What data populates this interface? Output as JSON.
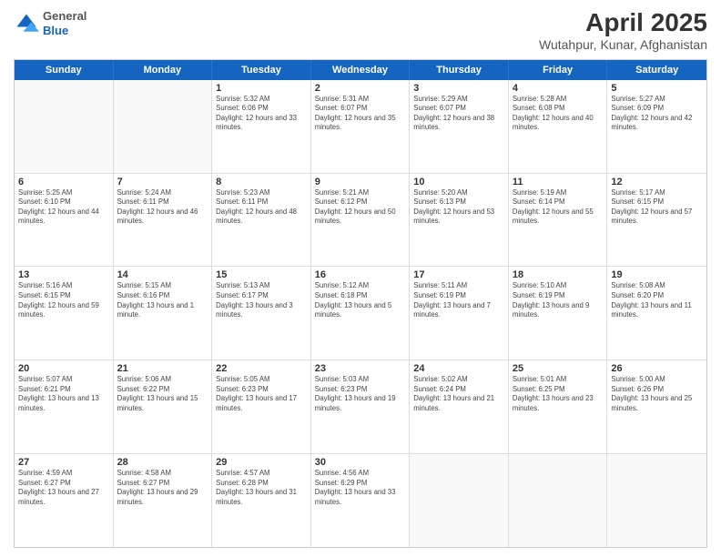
{
  "header": {
    "logo": {
      "general": "General",
      "blue": "Blue"
    },
    "title": "April 2025",
    "location": "Wutahpur, Kunar, Afghanistan"
  },
  "weekdays": [
    "Sunday",
    "Monday",
    "Tuesday",
    "Wednesday",
    "Thursday",
    "Friday",
    "Saturday"
  ],
  "weeks": [
    [
      {
        "day": "",
        "sunrise": "",
        "sunset": "",
        "daylight": ""
      },
      {
        "day": "",
        "sunrise": "",
        "sunset": "",
        "daylight": ""
      },
      {
        "day": "1",
        "sunrise": "Sunrise: 5:32 AM",
        "sunset": "Sunset: 6:06 PM",
        "daylight": "Daylight: 12 hours and 33 minutes."
      },
      {
        "day": "2",
        "sunrise": "Sunrise: 5:31 AM",
        "sunset": "Sunset: 6:07 PM",
        "daylight": "Daylight: 12 hours and 35 minutes."
      },
      {
        "day": "3",
        "sunrise": "Sunrise: 5:29 AM",
        "sunset": "Sunset: 6:07 PM",
        "daylight": "Daylight: 12 hours and 38 minutes."
      },
      {
        "day": "4",
        "sunrise": "Sunrise: 5:28 AM",
        "sunset": "Sunset: 6:08 PM",
        "daylight": "Daylight: 12 hours and 40 minutes."
      },
      {
        "day": "5",
        "sunrise": "Sunrise: 5:27 AM",
        "sunset": "Sunset: 6:09 PM",
        "daylight": "Daylight: 12 hours and 42 minutes."
      }
    ],
    [
      {
        "day": "6",
        "sunrise": "Sunrise: 5:25 AM",
        "sunset": "Sunset: 6:10 PM",
        "daylight": "Daylight: 12 hours and 44 minutes."
      },
      {
        "day": "7",
        "sunrise": "Sunrise: 5:24 AM",
        "sunset": "Sunset: 6:11 PM",
        "daylight": "Daylight: 12 hours and 46 minutes."
      },
      {
        "day": "8",
        "sunrise": "Sunrise: 5:23 AM",
        "sunset": "Sunset: 6:11 PM",
        "daylight": "Daylight: 12 hours and 48 minutes."
      },
      {
        "day": "9",
        "sunrise": "Sunrise: 5:21 AM",
        "sunset": "Sunset: 6:12 PM",
        "daylight": "Daylight: 12 hours and 50 minutes."
      },
      {
        "day": "10",
        "sunrise": "Sunrise: 5:20 AM",
        "sunset": "Sunset: 6:13 PM",
        "daylight": "Daylight: 12 hours and 53 minutes."
      },
      {
        "day": "11",
        "sunrise": "Sunrise: 5:19 AM",
        "sunset": "Sunset: 6:14 PM",
        "daylight": "Daylight: 12 hours and 55 minutes."
      },
      {
        "day": "12",
        "sunrise": "Sunrise: 5:17 AM",
        "sunset": "Sunset: 6:15 PM",
        "daylight": "Daylight: 12 hours and 57 minutes."
      }
    ],
    [
      {
        "day": "13",
        "sunrise": "Sunrise: 5:16 AM",
        "sunset": "Sunset: 6:15 PM",
        "daylight": "Daylight: 12 hours and 59 minutes."
      },
      {
        "day": "14",
        "sunrise": "Sunrise: 5:15 AM",
        "sunset": "Sunset: 6:16 PM",
        "daylight": "Daylight: 13 hours and 1 minute."
      },
      {
        "day": "15",
        "sunrise": "Sunrise: 5:13 AM",
        "sunset": "Sunset: 6:17 PM",
        "daylight": "Daylight: 13 hours and 3 minutes."
      },
      {
        "day": "16",
        "sunrise": "Sunrise: 5:12 AM",
        "sunset": "Sunset: 6:18 PM",
        "daylight": "Daylight: 13 hours and 5 minutes."
      },
      {
        "day": "17",
        "sunrise": "Sunrise: 5:11 AM",
        "sunset": "Sunset: 6:19 PM",
        "daylight": "Daylight: 13 hours and 7 minutes."
      },
      {
        "day": "18",
        "sunrise": "Sunrise: 5:10 AM",
        "sunset": "Sunset: 6:19 PM",
        "daylight": "Daylight: 13 hours and 9 minutes."
      },
      {
        "day": "19",
        "sunrise": "Sunrise: 5:08 AM",
        "sunset": "Sunset: 6:20 PM",
        "daylight": "Daylight: 13 hours and 11 minutes."
      }
    ],
    [
      {
        "day": "20",
        "sunrise": "Sunrise: 5:07 AM",
        "sunset": "Sunset: 6:21 PM",
        "daylight": "Daylight: 13 hours and 13 minutes."
      },
      {
        "day": "21",
        "sunrise": "Sunrise: 5:06 AM",
        "sunset": "Sunset: 6:22 PM",
        "daylight": "Daylight: 13 hours and 15 minutes."
      },
      {
        "day": "22",
        "sunrise": "Sunrise: 5:05 AM",
        "sunset": "Sunset: 6:23 PM",
        "daylight": "Daylight: 13 hours and 17 minutes."
      },
      {
        "day": "23",
        "sunrise": "Sunrise: 5:03 AM",
        "sunset": "Sunset: 6:23 PM",
        "daylight": "Daylight: 13 hours and 19 minutes."
      },
      {
        "day": "24",
        "sunrise": "Sunrise: 5:02 AM",
        "sunset": "Sunset: 6:24 PM",
        "daylight": "Daylight: 13 hours and 21 minutes."
      },
      {
        "day": "25",
        "sunrise": "Sunrise: 5:01 AM",
        "sunset": "Sunset: 6:25 PM",
        "daylight": "Daylight: 13 hours and 23 minutes."
      },
      {
        "day": "26",
        "sunrise": "Sunrise: 5:00 AM",
        "sunset": "Sunset: 6:26 PM",
        "daylight": "Daylight: 13 hours and 25 minutes."
      }
    ],
    [
      {
        "day": "27",
        "sunrise": "Sunrise: 4:59 AM",
        "sunset": "Sunset: 6:27 PM",
        "daylight": "Daylight: 13 hours and 27 minutes."
      },
      {
        "day": "28",
        "sunrise": "Sunrise: 4:58 AM",
        "sunset": "Sunset: 6:27 PM",
        "daylight": "Daylight: 13 hours and 29 minutes."
      },
      {
        "day": "29",
        "sunrise": "Sunrise: 4:57 AM",
        "sunset": "Sunset: 6:28 PM",
        "daylight": "Daylight: 13 hours and 31 minutes."
      },
      {
        "day": "30",
        "sunrise": "Sunrise: 4:56 AM",
        "sunset": "Sunset: 6:29 PM",
        "daylight": "Daylight: 13 hours and 33 minutes."
      },
      {
        "day": "",
        "sunrise": "",
        "sunset": "",
        "daylight": ""
      },
      {
        "day": "",
        "sunrise": "",
        "sunset": "",
        "daylight": ""
      },
      {
        "day": "",
        "sunrise": "",
        "sunset": "",
        "daylight": ""
      }
    ]
  ]
}
